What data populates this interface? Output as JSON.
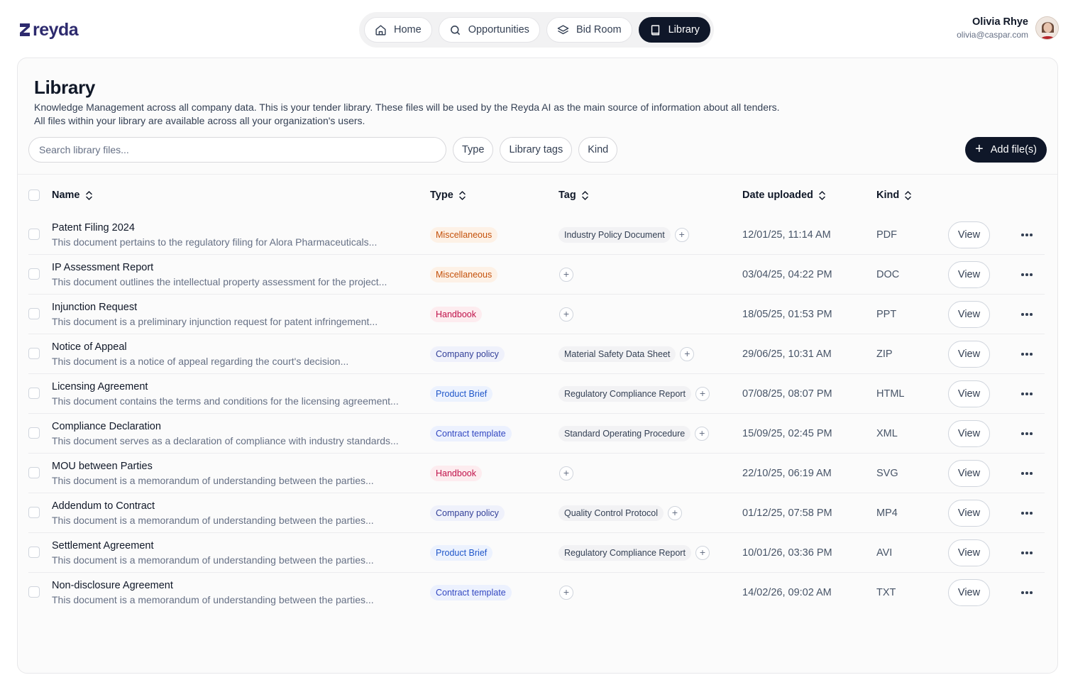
{
  "brand": {
    "name": "reyda",
    "color": "#2d2a6e"
  },
  "nav": [
    {
      "label": "Home",
      "icon": "home-icon",
      "active": false
    },
    {
      "label": "Opportunities",
      "icon": "search-icon",
      "active": false
    },
    {
      "label": "Bid Room",
      "icon": "layers-icon",
      "active": false
    },
    {
      "label": "Library",
      "icon": "book-icon",
      "active": true
    }
  ],
  "user": {
    "name": "Olivia Rhye",
    "email": "olivia@caspar.com"
  },
  "page": {
    "title": "Library",
    "description_line1": "Knowledge Management across all company data. This is your tender library. These files will be used by the Reyda AI as the main source of information about all tenders.",
    "description_line2": "All files within your library are available across all your organization's users."
  },
  "toolbar": {
    "search_placeholder": "Search library files...",
    "filters": [
      "Type",
      "Library tags",
      "Kind"
    ],
    "add_label": "Add file(s)"
  },
  "table": {
    "columns": [
      "Name",
      "Type",
      "Tag",
      "Date uploaded",
      "Kind"
    ],
    "view_label": "View",
    "rows": [
      {
        "title": "Patent Filing 2024",
        "desc": "This document pertains to the regulatory filing for Alora Pharmaceuticals...",
        "type": "Miscellaneous",
        "type_style": "misc",
        "tag": "Industry Policy Document",
        "date": "12/01/25, 11:14 AM",
        "kind": "PDF"
      },
      {
        "title": "IP Assessment Report",
        "desc": "This document outlines the intellectual property assessment for the project...",
        "type": "Miscellaneous",
        "type_style": "misc",
        "tag": "",
        "date": "03/04/25, 04:22 PM",
        "kind": "DOC"
      },
      {
        "title": "Injunction Request",
        "desc": "This document is a preliminary injunction request for patent infringement...",
        "type": "Handbook",
        "type_style": "hand",
        "tag": "",
        "date": "18/05/25, 01:53 PM",
        "kind": "PPT"
      },
      {
        "title": "Notice of Appeal",
        "desc": "This document is a notice of appeal regarding the court's decision...",
        "type": "Company policy",
        "type_style": "comp",
        "tag": "Material Safety Data Sheet",
        "date": "29/06/25, 10:31 AM",
        "kind": "ZIP"
      },
      {
        "title": "Licensing Agreement",
        "desc": "This document contains the terms and conditions for the licensing agreement...",
        "type": "Product Brief",
        "type_style": "prod",
        "tag": "Regulatory Compliance Report",
        "date": "07/08/25, 08:07 PM",
        "kind": "HTML"
      },
      {
        "title": "Compliance Declaration",
        "desc": "This document serves as a declaration of compliance with industry standards...",
        "type": "Contract template",
        "type_style": "contract",
        "tag": "Standard Operating Procedure",
        "date": "15/09/25, 02:45 PM",
        "kind": "XML"
      },
      {
        "title": "MOU between Parties",
        "desc": "This document is a memorandum of understanding between the parties...",
        "type": "Handbook",
        "type_style": "hand",
        "tag": "",
        "date": "22/10/25, 06:19 AM",
        "kind": "SVG"
      },
      {
        "title": "Addendum to Contract",
        "desc": "This document is a memorandum of understanding between the parties...",
        "type": "Company policy",
        "type_style": "comp",
        "tag": "Quality Control Protocol",
        "date": "01/12/25, 07:58 PM",
        "kind": "MP4"
      },
      {
        "title": "Settlement Agreement",
        "desc": "This document is a memorandum of understanding between the parties...",
        "type": "Product Brief",
        "type_style": "prod",
        "tag": "Regulatory Compliance Report",
        "date": "10/01/26, 03:36 PM",
        "kind": "AVI"
      },
      {
        "title": "Non-disclosure Agreement",
        "desc": "This document is a memorandum of understanding between the parties...",
        "type": "Contract template",
        "type_style": "contract",
        "tag": "",
        "date": "14/02/26, 09:02 AM",
        "kind": "TXT"
      }
    ]
  }
}
